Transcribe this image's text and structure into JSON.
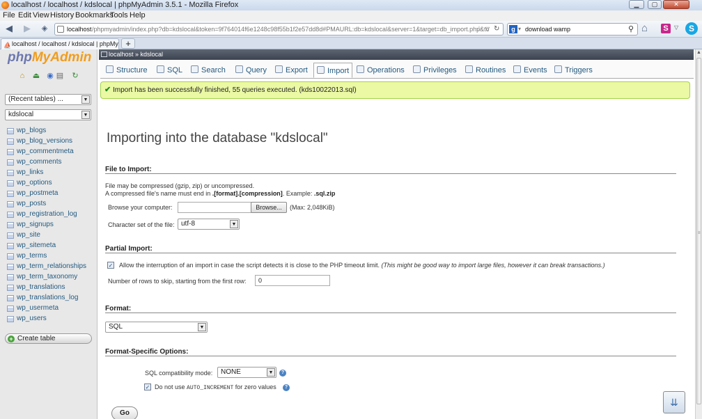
{
  "window": {
    "title": "localhost / localhost / kdslocal | phpMyAdmin 3.5.1 - Mozilla Firefox"
  },
  "menubar": [
    "File",
    "Edit",
    "View",
    "History",
    "Bookmarks",
    "Tools",
    "Help"
  ],
  "url": {
    "host": "localhost",
    "path": "/phpmyadmin/index.php?db=kdslocal&token=9f764014f6e1248c98f55b1f2e57dd8d#PMAURL:db=kdslocal&server=1&target=db_import.php&token="
  },
  "search": {
    "value": "download wamp"
  },
  "tab": {
    "label": "localhost / localhost / kdslocal | phpMy..."
  },
  "sidebar": {
    "logo_php": "php",
    "logo_my": "MyAdmin",
    "recent": "(Recent tables) ...",
    "db": "kdslocal",
    "tables": [
      "wp_blogs",
      "wp_blog_versions",
      "wp_commentmeta",
      "wp_comments",
      "wp_links",
      "wp_options",
      "wp_postmeta",
      "wp_posts",
      "wp_registration_log",
      "wp_signups",
      "wp_site",
      "wp_sitemeta",
      "wp_terms",
      "wp_term_relationships",
      "wp_term_taxonomy",
      "wp_translations",
      "wp_translations_log",
      "wp_usermeta",
      "wp_users"
    ],
    "create_table": "Create table"
  },
  "breadcrumb": "localhost » kdslocal",
  "topmenu": [
    "Structure",
    "SQL",
    "Search",
    "Query",
    "Export",
    "Import",
    "Operations",
    "Privileges",
    "Routines",
    "Events",
    "Triggers"
  ],
  "notice": "Import has been successfully finished, 55 queries executed. (kds10022013.sql)",
  "page_title": "Importing into the database \"kdslocal\"",
  "file_section": {
    "heading": "File to Import:",
    "line1": "File may be compressed (gzip, zip) or uncompressed.",
    "line2_a": "A compressed file's name must end in ",
    "line2_b": ".[format].[compression]",
    "line2_c": ". Example: ",
    "line2_d": ".sql.zip",
    "browse_label": "Browse your computer:",
    "browse_button": "Browse...",
    "max": "(Max: 2,048KiB)",
    "charset_label": "Character set of the file:",
    "charset": "utf-8"
  },
  "partial": {
    "heading": "Partial Import:",
    "allow": "Allow the interruption of an import in case the script detects it is close to the PHP timeout limit.",
    "allow_note": "(This might be good way to import large files, however it can break transactions.)",
    "skip_label": "Number of rows to skip, starting from the first row:",
    "skip_value": "0"
  },
  "format": {
    "heading": "Format:",
    "value": "SQL"
  },
  "fso": {
    "heading": "Format-Specific Options:",
    "compat_label": "SQL compatibility mode:",
    "compat_value": "NONE",
    "noauto_a": "Do not use ",
    "noauto_code": "AUTO_INCREMENT",
    "noauto_b": " for zero values"
  },
  "go": "Go",
  "colors": {
    "notice_bg": "#ebf8a4",
    "notice_border": "#a2d246",
    "link": "#235a81",
    "crumb": "#4d5461"
  }
}
